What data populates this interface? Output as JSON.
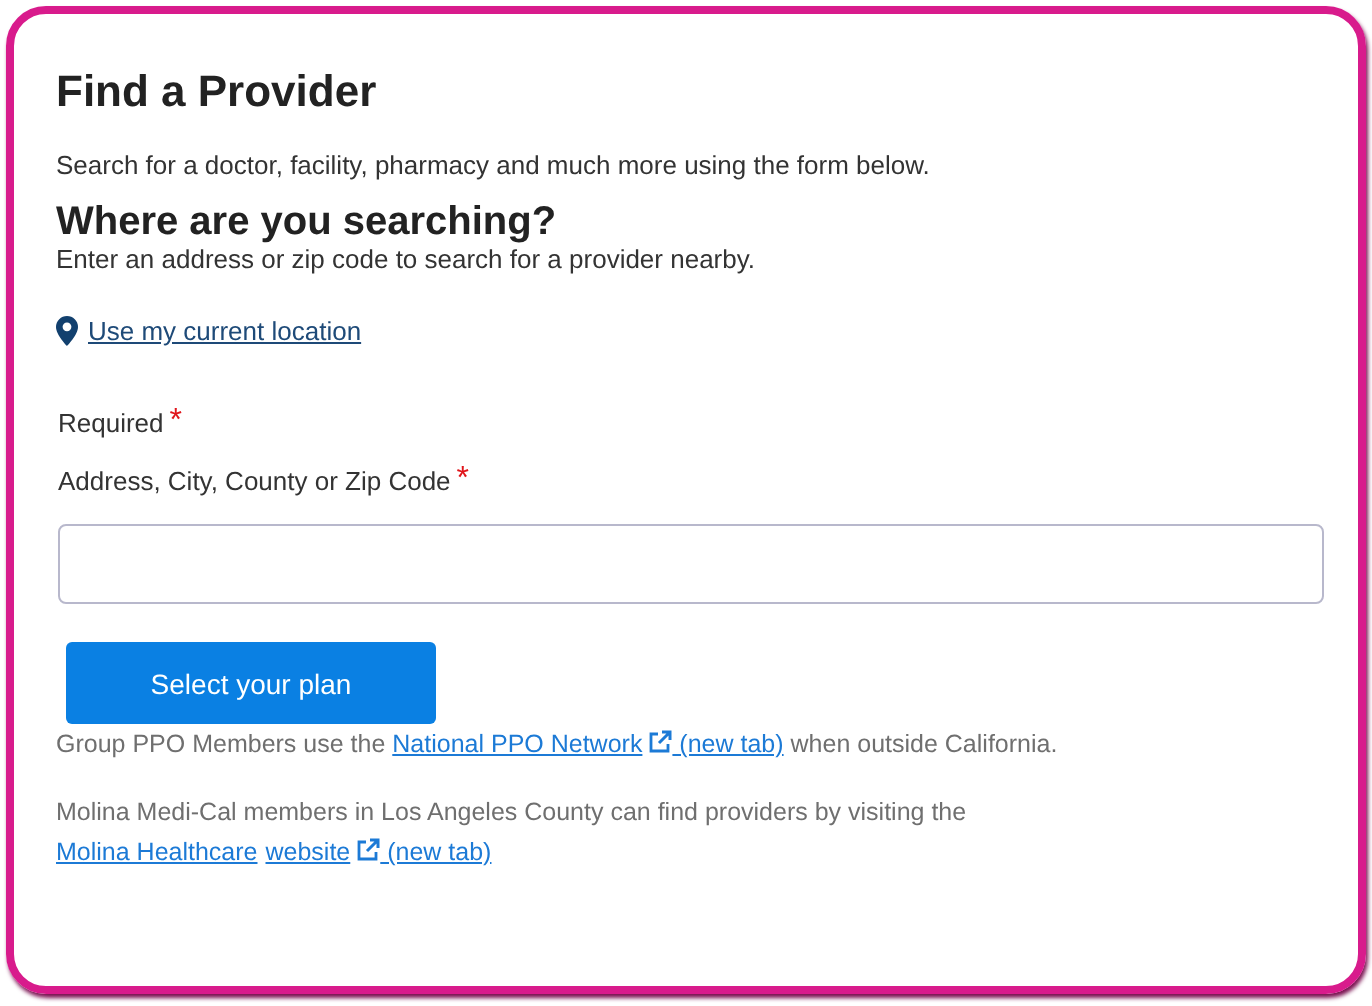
{
  "title": "Find a Provider",
  "intro": "Search for a doctor, facility, pharmacy and much more using the form below.",
  "section_title": "Where are you searching?",
  "section_hint": "Enter an address or zip code to search for a provider nearby.",
  "location_link": "Use my current location",
  "required_note": {
    "label": "Required",
    "marker": "*"
  },
  "address_field": {
    "label": "Address, City, County or Zip Code",
    "marker": "*"
  },
  "button": "Select your plan",
  "notes": [
    [
      {
        "kind": "text",
        "text": "Group PPO Members use the "
      },
      {
        "kind": "link",
        "text": "National PPO Network",
        "external": true,
        "note": "(new tab)"
      },
      {
        "kind": "text",
        "text": " when outside California."
      }
    ],
    [
      {
        "kind": "text",
        "text": "Molina Medi-Cal members in Los Angeles County can find providers by visiting the "
      },
      {
        "kind": "link",
        "text": "Molina Healthcare",
        "external": false
      },
      {
        "kind": "link",
        "text": "website",
        "external": true,
        "note": "(new tab)"
      }
    ]
  ]
}
